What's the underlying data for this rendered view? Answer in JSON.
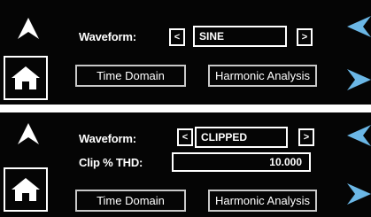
{
  "colors": {
    "panel_bg": "#050505",
    "foreground": "#ffffff",
    "button_border": "#c8c8c8",
    "accent_arrow": "#6bb7e6"
  },
  "icons": [
    "up-arrow-icon",
    "home-icon",
    "left-arrow-icon",
    "right-arrow-icon"
  ],
  "panels": [
    {
      "waveform_label": "Waveform:",
      "prev_symbol": "<",
      "waveform_value": "SINE",
      "next_symbol": ">",
      "buttons": {
        "time_domain": "Time Domain",
        "harmonic_analysis": "Harmonic Analysis"
      }
    },
    {
      "waveform_label": "Waveform:",
      "prev_symbol": "<",
      "waveform_value": "CLIPPED",
      "next_symbol": ">",
      "clip_label": "Clip % THD:",
      "clip_value": "10.000",
      "buttons": {
        "time_domain": "Time Domain",
        "harmonic_analysis": "Harmonic Analysis"
      }
    }
  ]
}
